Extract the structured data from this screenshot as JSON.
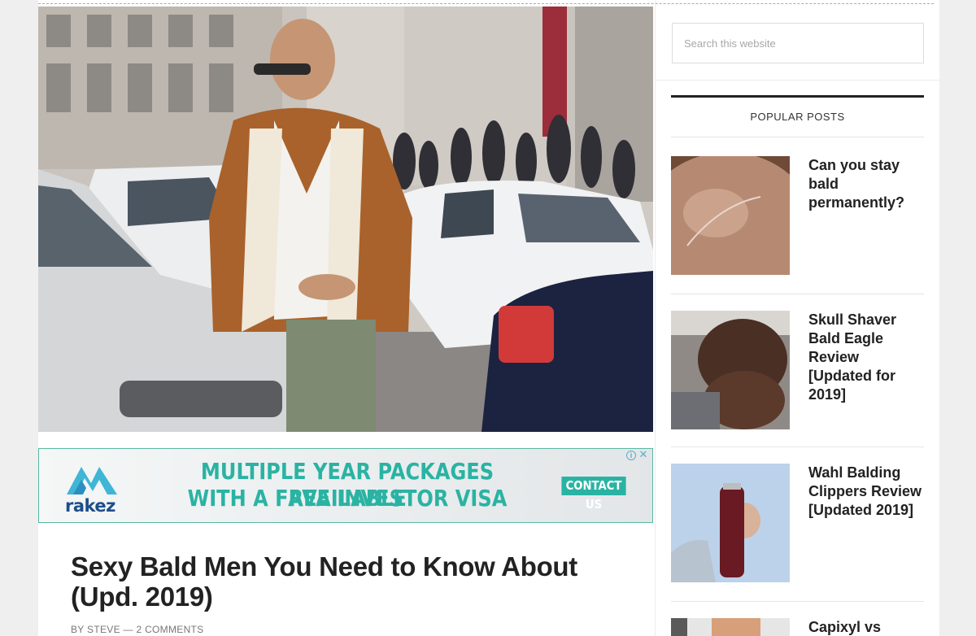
{
  "search": {
    "placeholder": "Search this website"
  },
  "ad": {
    "brand": "rakez",
    "line1": "MULTIPLE YEAR PACKAGES AVAILABLE",
    "line2": "WITH A FREE INVESTOR VISA",
    "cta": "CONTACT US",
    "info_icon": "i",
    "close_icon": "✕"
  },
  "post": {
    "title": "Sexy Bald Men You Need to Know About (Upd. 2019)",
    "meta_by": "BY ",
    "author": "STEVE",
    "meta_sep": " — ",
    "comments": "2 COMMENTS"
  },
  "sidebar": {
    "popular_posts_title": "POPULAR POSTS",
    "posts": [
      {
        "title": "Can you stay bald permanently?",
        "thumb": "bald-scalp-photo"
      },
      {
        "title": "Skull Shaver Bald Eagle Review [Updated for 2019]",
        "thumb": "bald-man-shaving-photo"
      },
      {
        "title": "Wahl Balding Clippers Review [Updated 2019]",
        "thumb": "hand-holding-clipper-photo"
      },
      {
        "title": "Capixyl vs",
        "thumb": "product-photo"
      }
    ]
  },
  "colors": {
    "accent": "#2ab3a3",
    "text": "#222222",
    "meta": "#777777"
  }
}
